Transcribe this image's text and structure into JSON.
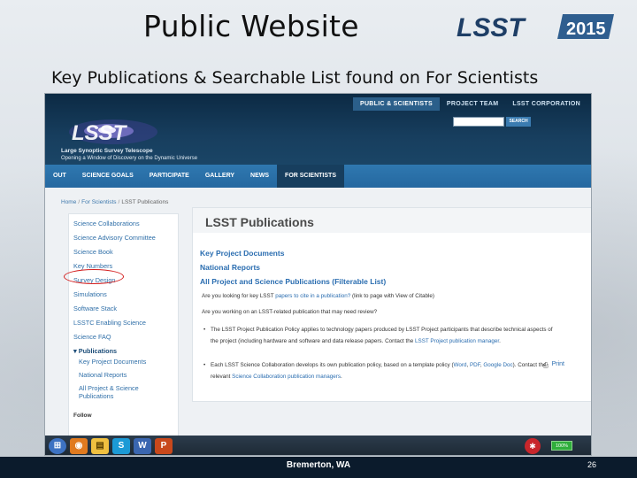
{
  "slide": {
    "title": "Public Website",
    "subtitle": "Key Publications & Searchable List found on For Scientists",
    "logo_text": "LSST",
    "logo_year": "2015",
    "footer_location": "Bremerton, WA",
    "page_number": "26"
  },
  "website": {
    "top_nav": [
      "PUBLIC & SCIENTISTS",
      "PROJECT TEAM",
      "LSST CORPORATION"
    ],
    "top_nav_active": "PUBLIC & SCIENTISTS",
    "search_button": "SEARCH",
    "logo_text": "LSST",
    "site_name": "Large Synoptic Survey Telescope",
    "site_tagline": "Opening a Window of Discovery on the Dynamic Universe",
    "main_nav": [
      "OUT",
      "SCIENCE GOALS",
      "PARTICIPATE",
      "GALLERY",
      "NEWS",
      "FOR SCIENTISTS"
    ],
    "main_nav_active": "FOR SCIENTISTS",
    "breadcrumb": [
      "Home",
      "For Scientists",
      "LSST Publications"
    ],
    "sidebar": {
      "items": [
        "Science Collaborations",
        "Science Advisory Committee",
        "Science Book",
        "Key Numbers",
        "Survey Design",
        "Simulations",
        "Software Stack",
        "LSSTC Enabling Science",
        "Science FAQ"
      ],
      "section": "Publications",
      "sub_items": [
        "Key Project Documents",
        "National Reports",
        "All Project & Science Publications"
      ],
      "follow_label": "Follow"
    },
    "content": {
      "heading": "LSST Publications",
      "links": [
        "Key Project Documents",
        "National Reports",
        "All Project and Science Publications (Filterable List)"
      ],
      "question1_pre": "Are you looking for key LSST ",
      "question1_link": "papers to cite in a publication?",
      "question1_post": " (link to page with View of Citable)",
      "question2": "Are you working on an LSST-related publication that may need review?",
      "bullet1_pre": "The LSST Project Publication Policy applies to technology papers produced by LSST Project participants that describe technical aspects of the project (including hardware and software and data release papers. Contact the ",
      "bullet1_link": "LSST Project publication manager",
      "bullet1_post": ".",
      "bullet2_pre": "Each LSST Science Collaboration develops its own publication policy, based on a template policy (",
      "bullet2_link1": "Word",
      "bullet2_mid1": ", ",
      "bullet2_link2": "PDF",
      "bullet2_mid2": ", ",
      "bullet2_link3": "Google Doc",
      "bullet2_mid3": "). Contact the relevant ",
      "bullet2_link4": "Science Collaboration publication managers",
      "bullet2_post": ".",
      "print_label": "Print"
    },
    "taskbar": {
      "battery_label": "100%"
    }
  },
  "colors": {
    "header_dark": "#0c2a44",
    "nav_blue": "#2f78b0",
    "link_blue": "#2a6db0",
    "highlight_red": "#d42020"
  }
}
